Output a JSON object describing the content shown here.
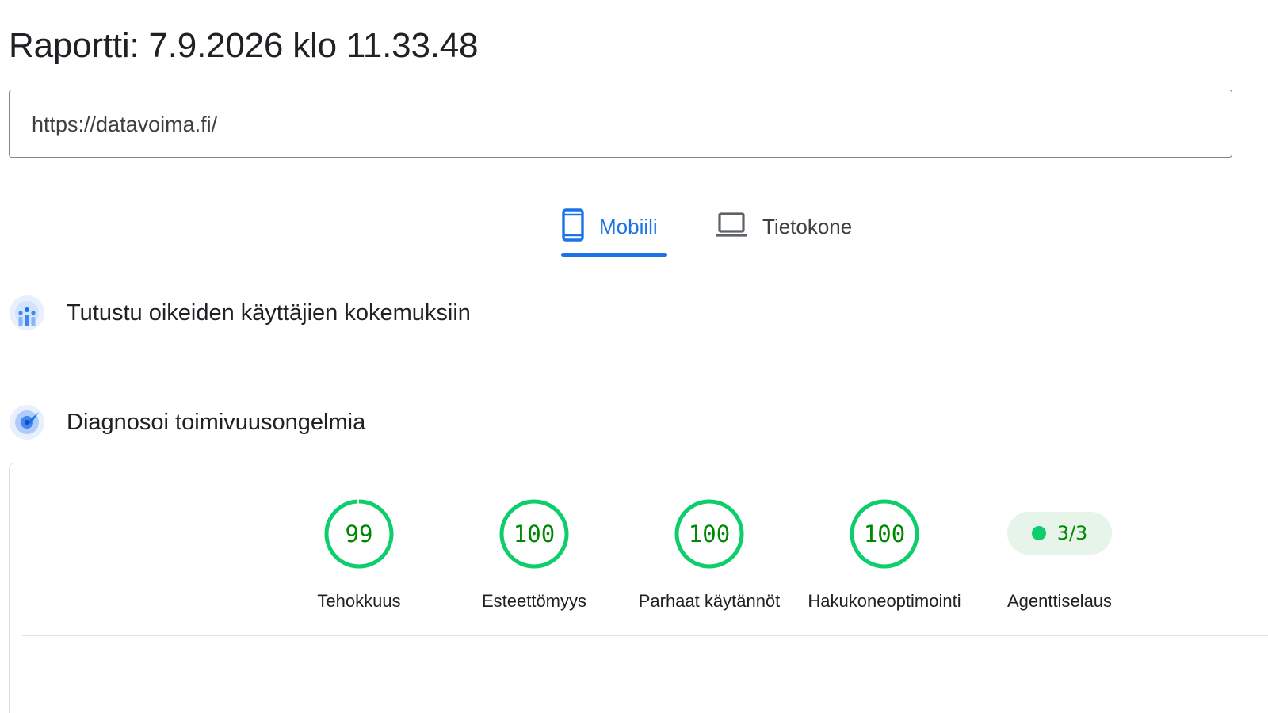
{
  "header": {
    "title": "Raportti: 7.9.2026 klo 11.33.48"
  },
  "url_field": {
    "value": "https://datavoima.fi/"
  },
  "tabs": [
    {
      "label": "Mobiili",
      "icon": "smartphone-icon",
      "active": true
    },
    {
      "label": "Tietokone",
      "icon": "laptop-icon",
      "active": false
    }
  ],
  "sections": {
    "real_users": {
      "title": "Tutustu oikeiden käyttäjien kokemuksiin",
      "icon": "crux-users-icon"
    },
    "diagnose": {
      "title": "Diagnosoi toimivuusongelmia",
      "icon": "lighthouse-compass-icon"
    }
  },
  "scores": [
    {
      "label": "Tehokkuus",
      "value": "99"
    },
    {
      "label": "Esteettömyys",
      "value": "100"
    },
    {
      "label": "Parhaat käytännöt",
      "value": "100"
    },
    {
      "label": "Hakukoneoptimointi",
      "value": "100"
    }
  ],
  "agent_browsing": {
    "label": "Agenttiselaus",
    "value": "3/3"
  },
  "colors": {
    "accent": "#1a73e8",
    "pass_green": "#0cce6b",
    "pass_text": "#008800",
    "pass_bg": "#e6f4ea"
  }
}
